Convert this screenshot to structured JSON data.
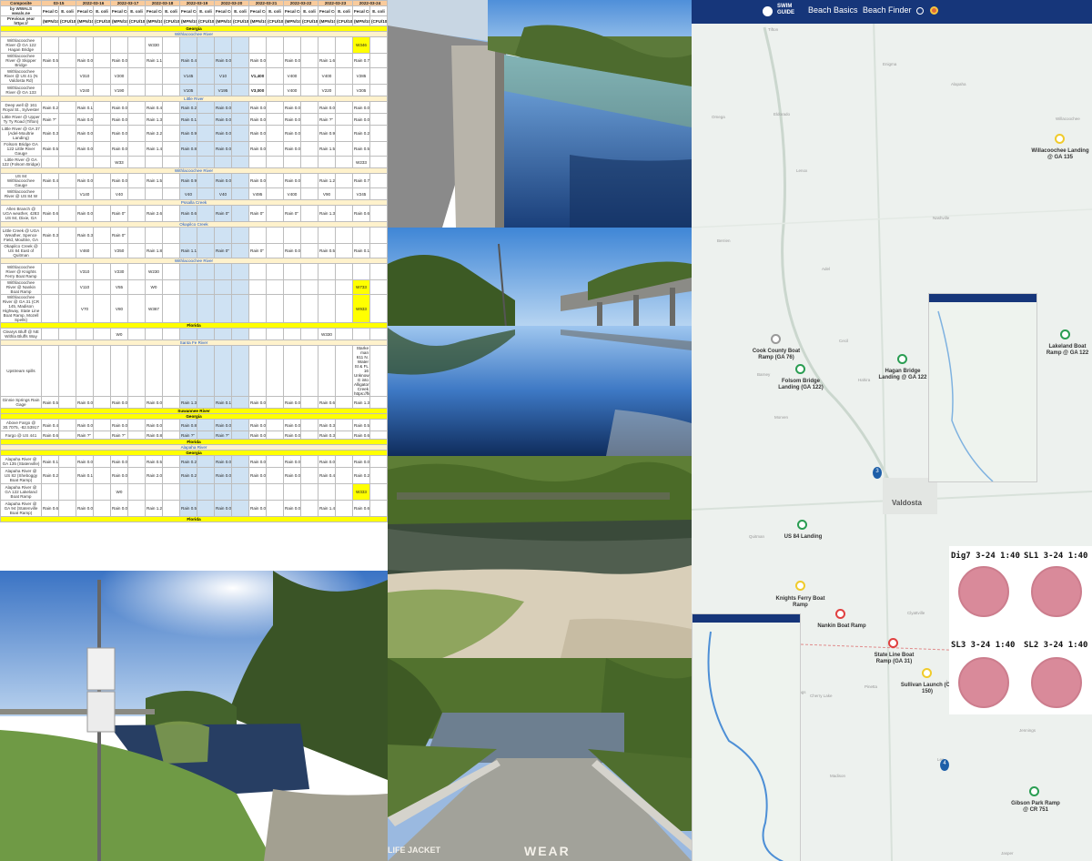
{
  "sheet": {
    "header_left": "Composite",
    "wwals_link": "by WWALS wwals.ne",
    "previous_link": "Previous year https://",
    "dates": [
      "03-15",
      "2022-03-16",
      "2022-03-17",
      "2022-03-18",
      "2022-03-19",
      "2022-03-20",
      "2022-03-21",
      "2022-03-22",
      "2022-03-23",
      "2022-03-24"
    ],
    "col_headers": [
      "Fecal Coliform",
      "E. coli"
    ],
    "unit_headers": [
      "(MPN/100 mL)",
      "(CFU/100 mL)"
    ],
    "sections": {
      "georgia": "Georgia",
      "withlacoochee": "Withlacoochee River",
      "little_river": "Little River",
      "pssalla": "Pssalla Creek",
      "okapilco": "Okapilco Creek",
      "withlacoochee2": "Withlacoochee River",
      "florida": "Florida",
      "santa_fe": "Santa Fe River",
      "suwannee": "Suwannee River",
      "alapaha": "Alapaha River"
    },
    "rows": [
      {
        "label": "Withlacoochee River @ GA 122 Hagan Bridge",
        "cells": [
          "",
          "",
          "",
          "W330",
          "",
          "",
          "",
          "",
          "",
          "W346"
        ]
      },
      {
        "label": "Withlacoochee River @ Skipper Bridge",
        "cells": [
          "Rain 0.52\"",
          "Rain 0.00\"",
          "Rain 0.00\"",
          "Rain 1.19\"",
          "Rain 0.48\"",
          "Rain 0.00\"",
          "Rain 0.00\"",
          "Rain 0.00\"",
          "Rain 1.67\"",
          "Rain 0.79\""
        ]
      },
      {
        "label": "Withlacoochee River @ US 41 (N Valdosta Rd)",
        "cells": [
          "",
          "V310",
          "V200",
          "",
          "V145",
          "V10",
          "V1,400",
          "V400",
          "V400",
          "V285"
        ]
      },
      {
        "label": "Withlacoochee River @ GA 133",
        "cells": [
          "",
          "V240",
          "V190",
          "",
          "V105",
          "V195",
          "V3,000",
          "V400",
          "V220",
          "V205"
        ]
      },
      {
        "label": "Deep well @ 161 Royal St., Sylvester",
        "cells": [
          "Rain 0.25\"",
          "Rain 0.12\"",
          "Rain 0.00\"",
          "Rain 0.42\"",
          "Rain 0.25\"",
          "Rain 0.00\"",
          "Rain 0.00\"",
          "Rain 0.00\"",
          "Rain 0.00\"",
          "Rain 0.00\""
        ]
      },
      {
        "label": "Little River @ Upper Ty Ty Road (Tifton)",
        "cells": [
          "Rain ?\"",
          "Rain 0.09\"",
          "Rain 0.00\"",
          "Rain 1.31\"",
          "Rain 0.19\"",
          "Rain 0.00\"",
          "Rain 0.00\"",
          "Rain 0.00\"",
          "Rain ?\"",
          "Rain 0.00\""
        ]
      },
      {
        "label": "Little River @ GA 37 (Adel-Moultrie Landing)",
        "cells": [
          "Rain 0.35\"",
          "Rain 0.09\"",
          "Rain 0.01\"",
          "Rain 2.20\"",
          "Rain 0.95\"",
          "Rain 0.00\"",
          "Rain 0.00\"",
          "Rain 0.00\"",
          "Rain 0.94\"",
          "Rain 0.28\""
        ]
      },
      {
        "label": "Folsom Bridge GA 122 Little River Gauge",
        "cells": [
          "Rain 0.54\"",
          "Rain 0.00\"",
          "Rain 0.00\"",
          "Rain 1.47\"",
          "Rain 0.82\"",
          "Rain 0.00\"",
          "Rain 0.00\"",
          "Rain 0.00\"",
          "Rain 1.55\"",
          "Rain 0.52\""
        ]
      },
      {
        "label": "Little River @ GA 122 (Folsom Bridge)",
        "cells": [
          "",
          "",
          "W33",
          "",
          "",
          "",
          "",
          "",
          "",
          "W233"
        ]
      },
      {
        "label": "US 84 Withlacoochee Gauge",
        "cells": [
          "Rain 0.49\"",
          "Rain 0.00\"",
          "Rain 0.00\"",
          "Rain 1.50\"",
          "Rain 0.95\"",
          "Rain 0.00\"",
          "Rain 0.00\"",
          "Rain 0.00\"",
          "Rain 1.27\"",
          "Rain 0.72\""
        ]
      },
      {
        "label": "Withlacoochee River @ US 84 W",
        "cells": [
          "",
          "V140",
          "V40",
          "",
          "V40",
          "V40",
          "V495",
          "V400",
          "V90",
          "V245"
        ]
      },
      {
        "label": "Allen Branch @ UGA weather, 4283 US 84, Dixie, GA",
        "cells": [
          "Rain 0.64\"",
          "Rain 0.04\"",
          "Rain 0\"",
          "Rain 2.61\"",
          "Rain 0.63\"",
          "Rain 0\"",
          "Rain 0\"",
          "Rain 0\"",
          "Rain 1.37\"",
          "Rain 0.65\""
        ]
      },
      {
        "label": "Little Creek @ UGA Weather, Spence Field, Moultrie, GA",
        "cells": [
          "Rain 0.35\"",
          "Rain 0.31\"",
          "Rain 0\"",
          "",
          "",
          "",
          "",
          "",
          "",
          ""
        ]
      },
      {
        "label": "Okapilco Creek @ US 84 East of Quitman",
        "cells": [
          "",
          "V460",
          "V250",
          "Rain 1.86\"",
          "Rain 1.18\"",
          "Rain 0\"",
          "Rain 0\"",
          "Rain 0.03\"",
          "Rain 0.51\"",
          "Rain 0.12\""
        ]
      },
      {
        "label": "Withlacoochee River @ Knights Ferry Boat Ramp",
        "cells": [
          "",
          "V310",
          "V230",
          "W230",
          "",
          "",
          "",
          "",
          "",
          ""
        ]
      },
      {
        "label": "Withlacoochee River @ Nankin Boat Ramp",
        "cells": [
          "",
          "V110",
          "V55",
          "W0",
          "",
          "",
          "",
          "",
          "",
          "W733"
        ]
      },
      {
        "label": "Withlacoochee River @ GA 31 (CR 145, Madison Highway, State Line Boat Ramp, Mozell Spells)",
        "cells": [
          "",
          "V70",
          "V80",
          "W367",
          "",
          "",
          "",
          "",
          "",
          "W933"
        ]
      },
      {
        "label": "Clearys Bluff @ NE Withla Bluffs Way",
        "cells": [
          "",
          "",
          "W0",
          "",
          "",
          "",
          "",
          "",
          "W330",
          ""
        ]
      },
      {
        "label": "Upstream spills",
        "cells": [
          "",
          "",
          "",
          "",
          "",
          "",
          "",
          "",
          "",
          "Starke man 611 N. Water St & FL 16 Unknown G into Alligator Creek https://floridadep.gov/ra"
        ]
      },
      {
        "label": "Ginnie Springs Rain Gage",
        "cells": [
          "Rain 0.54\"",
          "Rain 0.00\"",
          "Rain 0.00\"",
          "Rain 0.01\"",
          "Rain 1.36\"",
          "Rain 0.14\"",
          "Rain 0.00\"",
          "Rain 0.00\"",
          "Rain 0.66\"",
          "Rain 1.31\""
        ]
      },
      {
        "label": "Above Fargo @ 30.7075, -82.53917",
        "cells": [
          "Rain 0.44\"",
          "Rain 0.01\"",
          "Rain 0.00\"",
          "Rain 0.00\"",
          "Rain 0.86\"",
          "Rain 0.01\"",
          "Rain 0.00\"",
          "Rain 0.00\"",
          "Rain 0.32\"",
          "Rain 0.51\""
        ]
      },
      {
        "label": "Fargo @ US 441",
        "cells": [
          "Rain 0.68\"",
          "Rain ?\"",
          "Rain ?\"",
          "Rain 0.85\"",
          "Rain ?\"",
          "Rain ?\"",
          "Rain 0.00\"",
          "Rain 0.00\"",
          "Rain 0.37\"",
          "Rain 0.64\""
        ]
      },
      {
        "label": "Alapaha River @ GA 135 (Statenville)",
        "cells": [
          "Rain 0.17\"",
          "Rain 0.05\"",
          "Rain 0.00\"",
          "Rain 0.55\"",
          "Rain 0.21\"",
          "Rain 0.00\"",
          "Rain 0.00\"",
          "Rain 0.00\"",
          "Rain 0.09\"",
          "Rain 0.01\""
        ]
      },
      {
        "label": "Alapaha River @ US 82 (Sheboggy Boat Ramp)",
        "cells": [
          "Rain 0.26\"",
          "Rain 0.17\"",
          "Rain 0.01\"",
          "Rain 2.08\"",
          "Rain 0.24\"",
          "Rain 0.00\"",
          "Rain 0.00\"",
          "Rain 0.00\"",
          "Rain 0.43\"",
          "Rain 0.28\""
        ]
      },
      {
        "label": "Alapaha River @ GA 122 Lakeland Boat Ramp",
        "cells": [
          "",
          "",
          "W0",
          "",
          "",
          "",
          "",
          "",
          "",
          "W333"
        ]
      },
      {
        "label": "Alapaha River @ GA 94 (Statenville Boat Ramp)",
        "cells": [
          "Rain 0.60\"",
          "Rain 0.00\"",
          "Rain 0.00\"",
          "Rain 1.20\"",
          "Rain 0.57\"",
          "Rain 0.01\"",
          "Rain 0.00\"",
          "Rain 0.00\"",
          "Rain 1.48\"",
          "Rain 0.62\""
        ]
      }
    ]
  },
  "photos": {
    "boat_ramp_sign": "WEAR",
    "boat_ramp_sign2": "LIFE JACKET"
  },
  "map": {
    "brand_line1": "SWIM",
    "brand_line2": "GUIDE",
    "nav": [
      "Beach Basics",
      "Beach Finder"
    ],
    "city": "Valdosta",
    "towns": [
      "Tifton",
      "Enigma",
      "Alapaha",
      "Omega",
      "Eldorado",
      "Willacoochee",
      "Lenox",
      "Nashville",
      "Berrien",
      "Adel",
      "Cecil",
      "Hahira",
      "Barney",
      "Morven",
      "Quitman",
      "Clyattville",
      "Pinetta",
      "Madison",
      "Lake Park",
      "Blue Springs",
      "Cherry Lake",
      "Jasper",
      "Jennings",
      "Lee"
    ],
    "markers": [
      {
        "label": "Willacoochee Landing @ GA 135",
        "kind": "y"
      },
      {
        "label": "Cook County Boat Ramp (GA 76)",
        "kind": "g"
      },
      {
        "label": "Folsom Bridge Landing (GA 122)",
        "kind": "green"
      },
      {
        "label": "Hagan Bridge Landing @ GA 122",
        "kind": "green"
      },
      {
        "label": "Lakeland Boat Ramp @ GA 122",
        "kind": "green"
      },
      {
        "label": "US 84 Landing",
        "kind": "green"
      },
      {
        "label": "Knights Ferry Boat Ramp",
        "kind": "y"
      },
      {
        "label": "Nankin Boat Ramp",
        "kind": "r"
      },
      {
        "label": "State Line Boat Ramp (GA 31)",
        "kind": "r"
      },
      {
        "label": "Sullivan Launch (CR 150)",
        "kind": "y"
      },
      {
        "label": "Gibson Park Ramp @ CR 751",
        "kind": "green"
      }
    ],
    "clusters": [
      "3",
      "4"
    ],
    "plates": [
      "Dig7 3-24 1:40",
      "SL1 3-24 1:40",
      "SL3 3-24 1:40",
      "SL2 3-24 1:40"
    ],
    "colors": {
      "nav": "#16367a",
      "good": "#2a9d52",
      "caution": "#f0cb2b",
      "bad": "#e04040"
    }
  }
}
